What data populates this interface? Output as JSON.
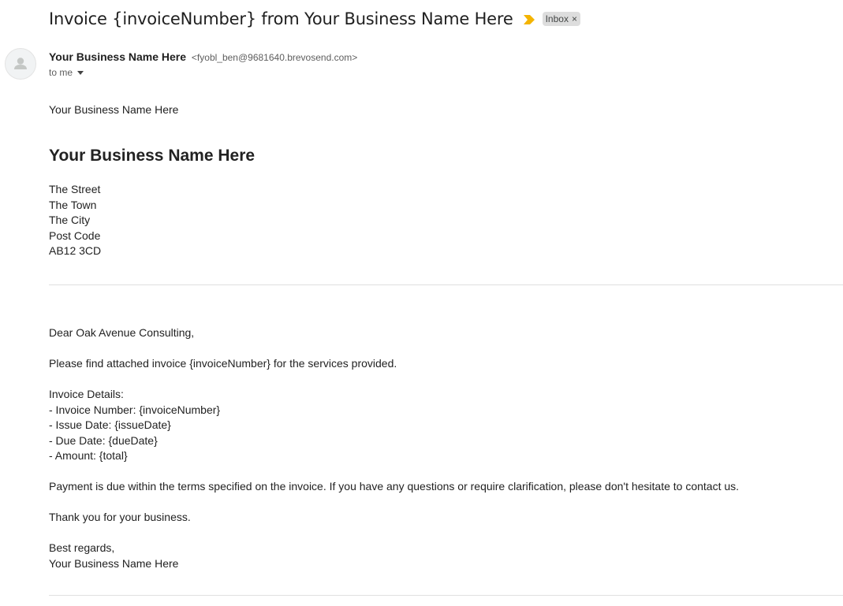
{
  "email": {
    "subject": "Invoice {invoiceNumber} from Your Business Name Here",
    "label": "Inbox",
    "label_close": "×",
    "sender_name": "Your Business Name Here",
    "sender_email": "<fyobl_ben@9681640.brevosend.com>",
    "to_line": "to me",
    "importance_color": "#f4b400"
  },
  "body": {
    "logo_alt": "Your Business Name Here",
    "business_heading": "Your Business Name Here",
    "address": [
      "The Street",
      "The Town",
      "The City",
      "Post Code",
      "AB12 3CD"
    ],
    "greeting": "Dear Oak Avenue Consulting,",
    "intro": "Please find attached invoice {invoiceNumber} for the services provided.",
    "details_heading": "Invoice Details:",
    "details": [
      "- Invoice Number: {invoiceNumber}",
      "- Issue Date: {issueDate}",
      "- Due Date: {dueDate}",
      "- Amount: {total}"
    ],
    "payment_note": "Payment is due within the terms specified on the invoice. If you have any questions or require clarification, please don't hesitate to contact us.",
    "thanks": "Thank you for your business.",
    "signoff": "Best regards,",
    "signature": "Your Business Name Here"
  }
}
